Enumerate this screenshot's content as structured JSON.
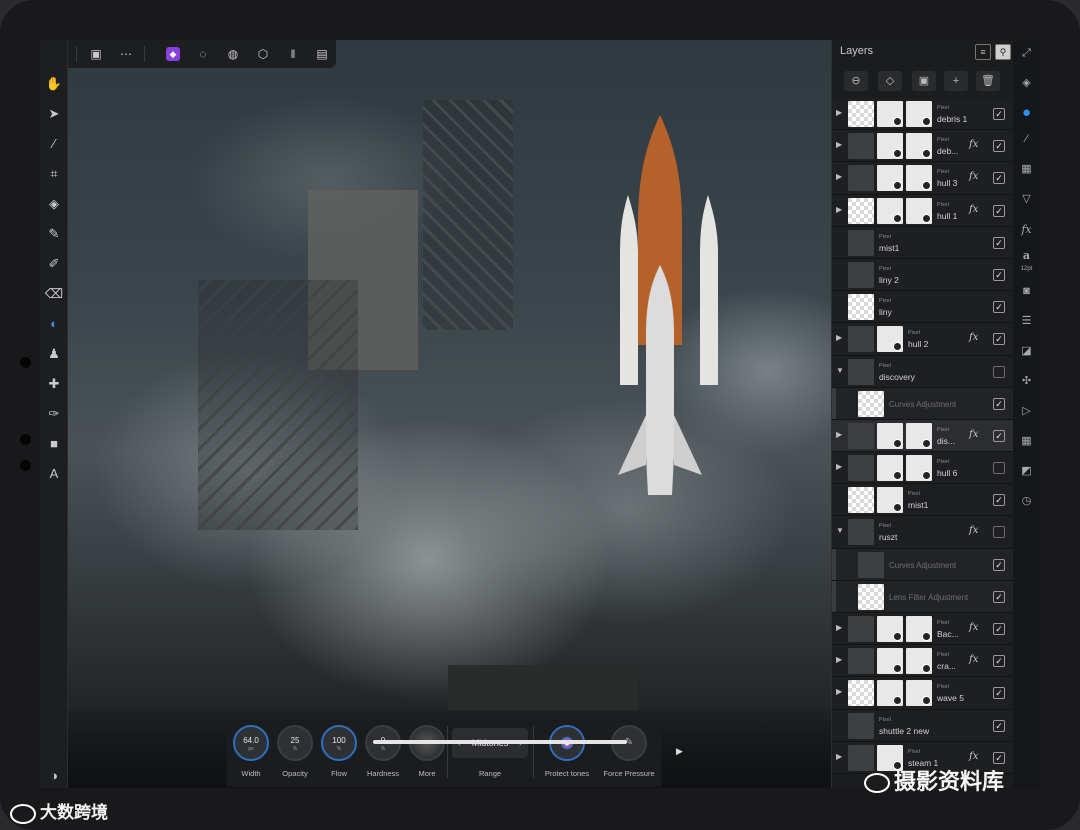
{
  "panel": {
    "title": "Layers"
  },
  "layers": [
    {
      "type": "Pixel",
      "name": "debris 1",
      "arrow": "▶",
      "fx": "",
      "checked": true,
      "thumbs": 3
    },
    {
      "type": "Pixel",
      "name": "deb...",
      "arrow": "▶",
      "fx": "fx",
      "checked": true,
      "thumbs": 3
    },
    {
      "type": "Pixel",
      "name": "hull 3",
      "arrow": "▶",
      "fx": "fx",
      "checked": true,
      "thumbs": 3
    },
    {
      "type": "Pixel",
      "name": "hull 1",
      "arrow": "▶",
      "fx": "fx",
      "checked": true,
      "thumbs": 3
    },
    {
      "type": "Pixel",
      "name": "mist1",
      "arrow": "",
      "fx": "",
      "checked": true,
      "thumbs": 1
    },
    {
      "type": "Pixel",
      "name": "liny 2",
      "arrow": "",
      "fx": "",
      "checked": true,
      "thumbs": 1
    },
    {
      "type": "Pixel",
      "name": "liny",
      "arrow": "",
      "fx": "",
      "checked": true,
      "thumbs": 1
    },
    {
      "type": "Pixel",
      "name": "hull 2",
      "arrow": "▶",
      "fx": "fx",
      "checked": true,
      "thumbs": 2
    },
    {
      "type": "Pixel",
      "name": "discovery",
      "arrow": "▼",
      "fx": "",
      "checked": false,
      "thumbs": 1
    },
    {
      "type": "",
      "name": "Curves Adjustment",
      "arrow": "",
      "fx": "",
      "checked": true,
      "thumbs": 1,
      "adjustment": true
    },
    {
      "type": "Pixel",
      "name": "dis...",
      "arrow": "▶",
      "fx": "fx",
      "checked": true,
      "thumbs": 3,
      "selected": true
    },
    {
      "type": "Pixel",
      "name": "hull 6",
      "arrow": "▶",
      "fx": "",
      "checked": false,
      "thumbs": 3
    },
    {
      "type": "Pixel",
      "name": "mist1",
      "arrow": "",
      "fx": "",
      "checked": true,
      "thumbs": 2
    },
    {
      "type": "Pixel",
      "name": "ruszt",
      "arrow": "▼",
      "fx": "fx",
      "checked": false,
      "thumbs": 1
    },
    {
      "type": "",
      "name": "Curves Adjustment",
      "arrow": "",
      "fx": "",
      "checked": true,
      "thumbs": 1,
      "adjustment": true
    },
    {
      "type": "",
      "name": "Lens Filter Adjustment",
      "arrow": "",
      "fx": "",
      "checked": true,
      "thumbs": 1,
      "adjustment": true
    },
    {
      "type": "Pixel",
      "name": "Bac...",
      "arrow": "▶",
      "fx": "fx",
      "checked": true,
      "thumbs": 3
    },
    {
      "type": "Pixel",
      "name": "cra...",
      "arrow": "▶",
      "fx": "fx",
      "checked": true,
      "thumbs": 3
    },
    {
      "type": "Pixel",
      "name": "wave 5",
      "arrow": "▶",
      "fx": "",
      "checked": true,
      "thumbs": 3
    },
    {
      "type": "Pixel",
      "name": "shuttle 2 new",
      "arrow": "",
      "fx": "",
      "checked": true,
      "thumbs": 1
    },
    {
      "type": "Pixel",
      "name": "steam 1",
      "arrow": "▶",
      "fx": "fx",
      "checked": true,
      "thumbs": 2
    }
  ],
  "context": {
    "width": {
      "value": "64.0",
      "unit": "px",
      "label": "Width"
    },
    "opacity": {
      "value": "25",
      "unit": "%",
      "label": "Opacity"
    },
    "flow": {
      "value": "100",
      "unit": "%",
      "label": "Flow"
    },
    "hardness": {
      "value": "0",
      "unit": "%",
      "label": "Hardness"
    },
    "more": {
      "label": "More"
    },
    "range": {
      "value": "Midtones",
      "label": "Range"
    },
    "protect": {
      "label": "Protect tones"
    },
    "force": {
      "label": "Force Pressure"
    }
  },
  "studio": {
    "font_size": "12pt"
  },
  "watermark": {
    "left": "大数跨境",
    "right": "摄影资料库"
  },
  "colors": {
    "accent": "#3d8cf5",
    "panel": "#1b1c1e",
    "persona": "#8a3fe0"
  }
}
